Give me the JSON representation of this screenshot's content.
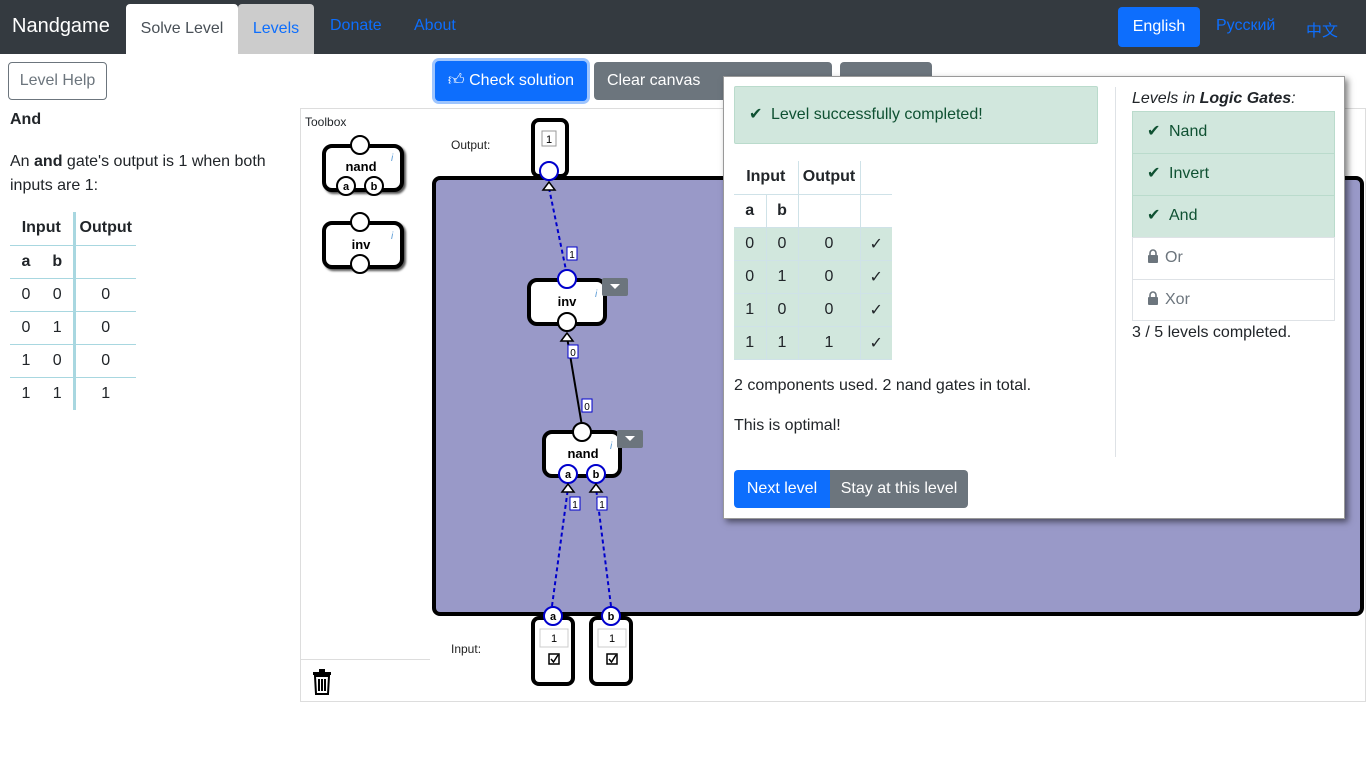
{
  "navbar": {
    "brand": "Nandgame",
    "tabs": [
      "Solve Level",
      "Levels"
    ],
    "links": [
      "Donate",
      "About"
    ],
    "languages": [
      "English",
      "Русский",
      "中文"
    ]
  },
  "left": {
    "help_button": "Level Help",
    "title": "And",
    "desc_pre": "An ",
    "desc_bold": "and",
    "desc_post": " gate's output is 1 when both inputs are 1:",
    "table": {
      "headers": [
        "Input",
        "Output"
      ],
      "subheaders": [
        "a",
        "b"
      ],
      "rows": [
        [
          "0",
          "0",
          "0"
        ],
        [
          "0",
          "1",
          "0"
        ],
        [
          "1",
          "0",
          "0"
        ],
        [
          "1",
          "1",
          "1"
        ]
      ]
    }
  },
  "toolbar": {
    "check": "Check solution",
    "clear": "Clear canvas"
  },
  "toolbox": {
    "label": "Toolbox",
    "components": [
      "nand",
      "inv"
    ]
  },
  "canvas": {
    "output_label": "Output:",
    "input_label": "Input:",
    "output_value": "1",
    "inv_label": "inv",
    "nand_label": "nand",
    "pin_a": "a",
    "pin_b": "b",
    "wire_values": [
      "1",
      "0",
      "0",
      "1",
      "1"
    ],
    "input_values": [
      "1",
      "1"
    ]
  },
  "popup": {
    "alert": "Level successfully completed!",
    "table": {
      "headers": [
        "Input",
        "Output"
      ],
      "subheaders": [
        "a",
        "b"
      ],
      "rows": [
        [
          "0",
          "0",
          "0",
          "✓"
        ],
        [
          "0",
          "1",
          "0",
          "✓"
        ],
        [
          "1",
          "0",
          "0",
          "✓"
        ],
        [
          "1",
          "1",
          "1",
          "✓"
        ]
      ]
    },
    "components_text": "2 components used. 2 nand gates in total.",
    "optimal_text": "This is optimal!",
    "next_button": "Next level",
    "stay_button": "Stay at this level",
    "levels_prefix": "Levels in ",
    "levels_group": "Logic Gates",
    "levels_suffix": ":",
    "levels": [
      {
        "name": "Nand",
        "status": "done"
      },
      {
        "name": "Invert",
        "status": "done"
      },
      {
        "name": "And",
        "status": "done"
      },
      {
        "name": "Or",
        "status": "locked"
      },
      {
        "name": "Xor",
        "status": "locked"
      }
    ],
    "progress": "3 / 5 levels completed."
  },
  "colors": {
    "navbar": "#343a40",
    "primary": "#0d6efd",
    "canvas": "#9999c8",
    "success_bg": "#d1e7dd"
  }
}
